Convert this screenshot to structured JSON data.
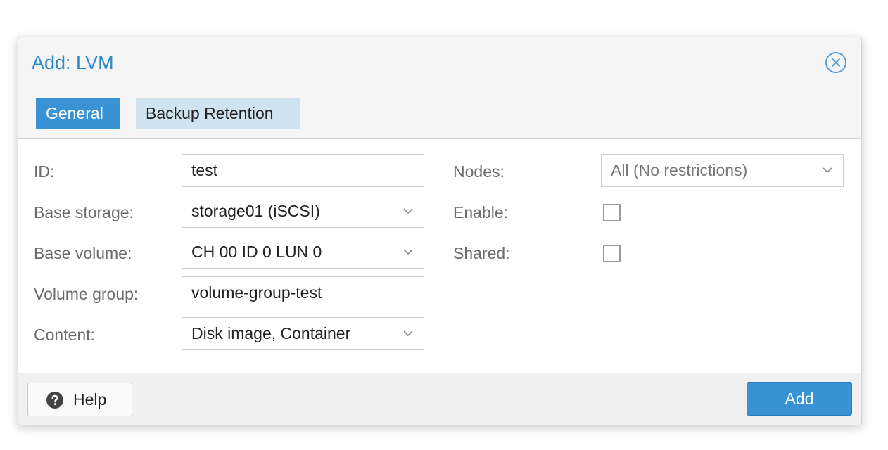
{
  "dialog": {
    "title": "Add: LVM"
  },
  "tabs": [
    {
      "label": "General",
      "active": true
    },
    {
      "label": "Backup Retention",
      "active": false
    }
  ],
  "form": {
    "left": [
      {
        "label": "ID:",
        "value": "test",
        "type": "text"
      },
      {
        "label": "Base storage:",
        "value": "storage01 (iSCSI)",
        "type": "select"
      },
      {
        "label": "Base volume:",
        "value": "CH 00 ID 0 LUN 0",
        "type": "select"
      },
      {
        "label": "Volume group:",
        "value": "volume-group-test",
        "type": "text"
      },
      {
        "label": "Content:",
        "value": "Disk image, Container",
        "type": "select"
      }
    ],
    "right": {
      "nodes": {
        "label": "Nodes:",
        "placeholder": "All (No restrictions)"
      },
      "enable": {
        "label": "Enable:",
        "checked": false
      },
      "shared": {
        "label": "Shared:",
        "checked": false
      }
    }
  },
  "footer": {
    "help_label": "Help",
    "add_label": "Add"
  },
  "colors": {
    "accent": "#3892d4",
    "title": "#2d8ac9",
    "tab_inactive": "#cfe3f1"
  },
  "icons": {
    "close": "close-circle-icon",
    "help": "question-circle-icon",
    "dropdown": "chevron-down-icon"
  }
}
